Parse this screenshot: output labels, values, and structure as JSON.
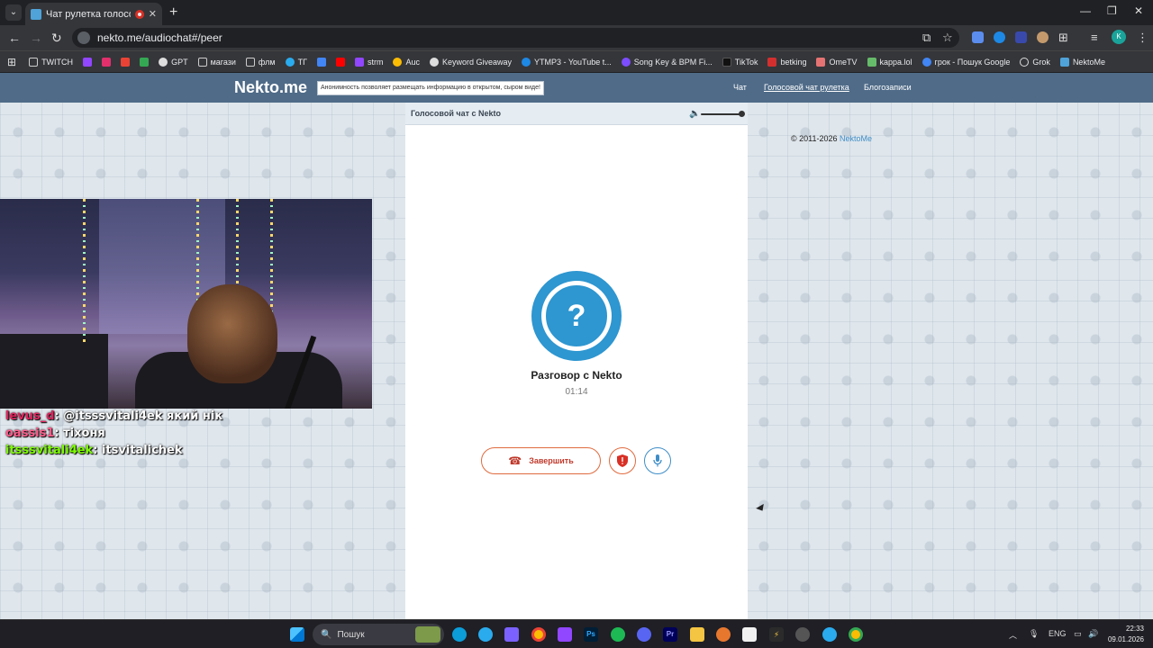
{
  "browser": {
    "tab_title": "Чат рулетка голосовая — I",
    "url": "nekto.me/audiochat#/peer",
    "bookmarks": [
      {
        "label": "TWITCH",
        "color": "#cccccc"
      },
      {
        "label": "",
        "color": "#9146ff"
      },
      {
        "label": "",
        "color": "#e1306c"
      },
      {
        "label": "",
        "color": "#ea4335"
      },
      {
        "label": "",
        "color": "#34a853"
      },
      {
        "label": "GPT",
        "color": "#dddddd"
      },
      {
        "label": "магази",
        "color": "#cccccc"
      },
      {
        "label": "флм",
        "color": "#cccccc"
      },
      {
        "label": "ТГ",
        "color": "#2aabee"
      },
      {
        "label": "",
        "color": "#4285f4"
      },
      {
        "label": "",
        "color": "#ff0000"
      },
      {
        "label": "strm",
        "color": "#9146ff"
      },
      {
        "label": "Auc",
        "color": "#fbbc04"
      },
      {
        "label": "Keyword Giveaway",
        "color": "#dddddd"
      },
      {
        "label": "YTMP3 - YouTube t...",
        "color": "#1e88e5"
      },
      {
        "label": "Song Key & BPM Fi...",
        "color": "#7c4dff"
      },
      {
        "label": "TikTok",
        "color": "#111111"
      },
      {
        "label": "betking",
        "color": "#d32f2f"
      },
      {
        "label": "OmeTV",
        "color": "#e57373"
      },
      {
        "label": "kappa.lol",
        "color": "#66bb6a"
      },
      {
        "label": "грок - Пошук Google",
        "color": "#4285f4"
      },
      {
        "label": "Grok",
        "color": "#dddddd"
      },
      {
        "label": "NektoMe",
        "color": "#4fa3d9"
      }
    ]
  },
  "site": {
    "logo": "Nekto.me",
    "notice": "Анонимность позволяет размещать информацию в открытом, сыром виде!",
    "nav": [
      "Чат",
      "Голосовой чат рулетка",
      "Блогозаписи"
    ]
  },
  "chat": {
    "panel_title": "Голосовой чат с Nekto",
    "avatar_symbol": "?",
    "peer_name": "Разговор с Nekto",
    "timer": "01:14",
    "end_button": "Завершить",
    "volume": 1.0
  },
  "footer": {
    "copyright": "© 2011-2026",
    "brand": "NektoMe"
  },
  "stream_chat": [
    {
      "user": "levus_d",
      "color": "#e0245e",
      "text": ": @itsssvitali4ek який нік"
    },
    {
      "user": "oassis1",
      "color": "#ff5c8a",
      "text": ": тіхоня"
    },
    {
      "user": "itsssvitali4ek",
      "color": "#7cfc00",
      "text": ": itsvitalichek"
    }
  ],
  "taskbar": {
    "search_placeholder": "Пошук",
    "language": "ENG",
    "time": "22:33",
    "date": "09.01.2026"
  }
}
